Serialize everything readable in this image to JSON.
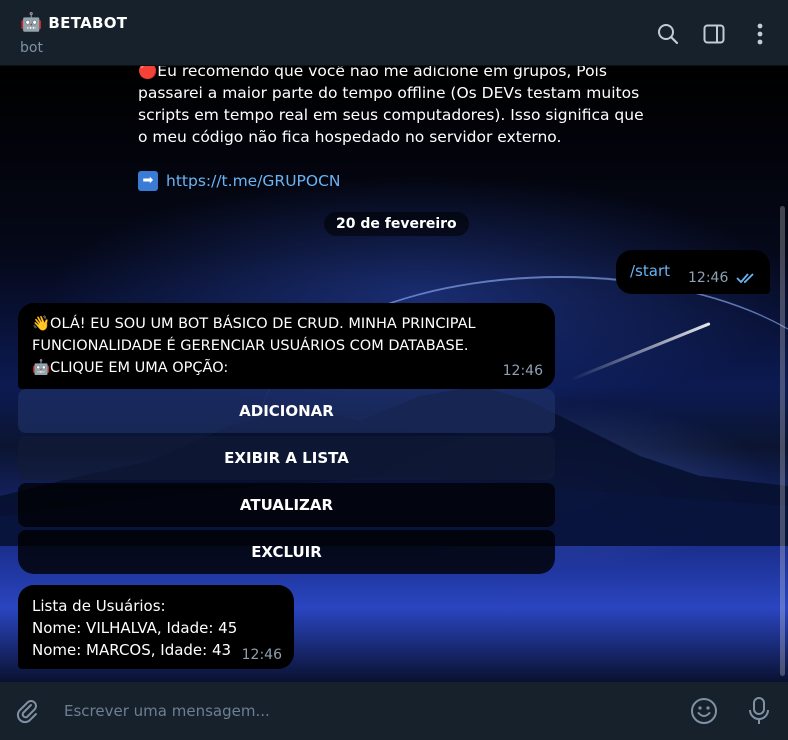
{
  "header": {
    "emoji": "🤖",
    "title": "BETABOT",
    "subtitle": "bot",
    "icons": [
      "search-icon",
      "sidebar-toggle-icon",
      "more-vert-icon"
    ]
  },
  "chat": {
    "previous_message": {
      "line1": "🔴Eu recomendo que você não me adicione em grupos, Pois passarei a maior parte do tempo offline (Os DEVs testam muitos scripts em tempo real em seus computadores). Isso significa que o meu código não fica hospedado no servidor externo.",
      "arrow": "➡",
      "link": "https://t.me/GRUPOCN"
    },
    "date_separator": "20 de fevereiro",
    "outgoing": {
      "text": "/start",
      "time": "12:46"
    },
    "incoming": {
      "lines": [
        "👋OLÁ! EU SOU UM BOT BÁSICO DE CRUD. MINHA PRINCIPAL FUNCIONALIDADE É GERENCIAR USUÁRIOS COM DATABASE.",
        "🤖CLIQUE EM UMA OPÇÃO:"
      ],
      "time": "12:46"
    },
    "keyboard": [
      "ADICIONAR",
      "EXIBIR A LISTA",
      "ATUALIZAR",
      "EXCLUIR"
    ],
    "list_message": {
      "lines": [
        "Lista de Usuários:",
        "Nome: VILHALVA, Idade: 45",
        "Nome: MARCOS, Idade: 43"
      ],
      "time": "12:46"
    }
  },
  "composer": {
    "placeholder": "Escrever uma mensagem..."
  },
  "colors": {
    "header_bg": "#17212b",
    "link": "#6ab3f3",
    "bubble_bg": "#000000",
    "muted": "#8fa0b3"
  }
}
